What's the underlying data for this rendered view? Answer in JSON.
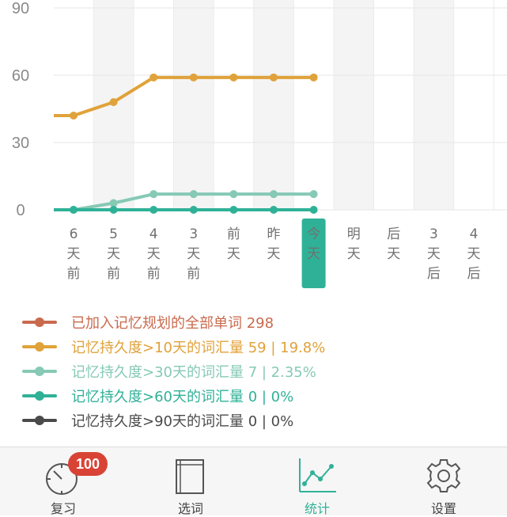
{
  "chart_data": {
    "type": "line",
    "categories": [
      "6\n天\n前",
      "5\n天\n前",
      "4\n天\n前",
      "3\n天\n前",
      "前\n天",
      "昨\n天",
      "今\n天",
      "明\n天",
      "后\n天",
      "3\n天\n后",
      "4\n天\n后"
    ],
    "today_index": 6,
    "yticks": [
      0,
      30,
      60,
      90
    ],
    "ylim": [
      0,
      90
    ],
    "grid": true,
    "series": [
      {
        "name": "记忆持久度>10天的词汇量",
        "color": "#e0a23a",
        "values": [
          42,
          42,
          48,
          59,
          59,
          59,
          59,
          59
        ]
      },
      {
        "name": "记忆持久度>30天的词汇量",
        "color": "#86c9b5",
        "values": [
          0,
          0,
          3,
          7,
          7,
          7,
          7,
          7
        ]
      },
      {
        "name": "记忆持久度>60天的词汇量",
        "color": "#2fb197",
        "values": [
          0,
          0,
          0,
          0,
          0,
          0,
          0,
          0
        ]
      }
    ]
  },
  "legend": [
    {
      "text": "已加入记忆规划的全部单词 298",
      "color": "#c96a4d"
    },
    {
      "text": "记忆持久度>10天的词汇量 59 | 19.8%",
      "color": "#e0a23a"
    },
    {
      "text": "记忆持久度>30天的词汇量 7 | 2.35%",
      "color": "#86c9b5"
    },
    {
      "text": "记忆持久度>60天的词汇量 0 | 0%",
      "color": "#2fb197"
    },
    {
      "text": "记忆持久度>90天的词汇量 0 | 0%",
      "color": "#4a4a4a"
    }
  ],
  "tabs": [
    {
      "label": "复习",
      "icon": "stopwatch-icon",
      "badge": "100"
    },
    {
      "label": "选词",
      "icon": "notebook-icon"
    },
    {
      "label": "统计",
      "icon": "line-chart-icon",
      "active": true
    },
    {
      "label": "设置",
      "icon": "gear-icon"
    }
  ],
  "colors": {
    "accent": "#2fb197",
    "badge": "#d84336"
  }
}
